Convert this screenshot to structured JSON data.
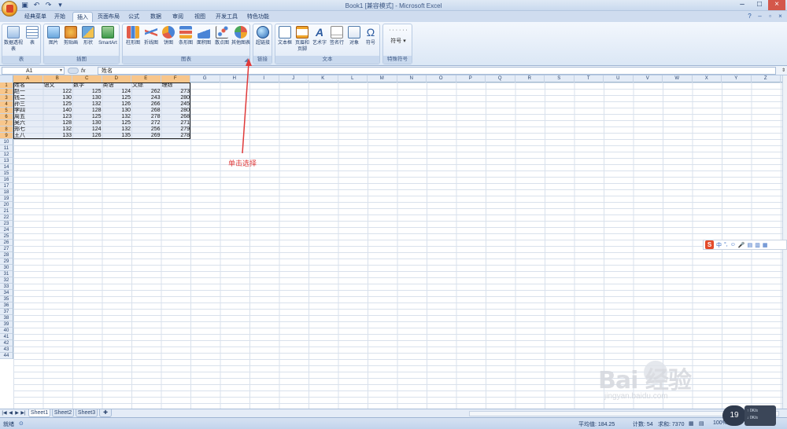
{
  "window": {
    "title": "Book1  [兼容模式] - Microsoft Excel"
  },
  "quick_access": {
    "icons": [
      "save-icon",
      "undo-icon",
      "redo-icon",
      "customize-icon"
    ]
  },
  "tabs": [
    {
      "label": "经典菜单"
    },
    {
      "label": "开始"
    },
    {
      "label": "插入",
      "active": true
    },
    {
      "label": "页面布局"
    },
    {
      "label": "公式"
    },
    {
      "label": "数据"
    },
    {
      "label": "审阅"
    },
    {
      "label": "视图"
    },
    {
      "label": "开发工具"
    },
    {
      "label": "特色功能"
    }
  ],
  "ribbon": {
    "groups": {
      "table": {
        "label": "表",
        "buttons": [
          {
            "label": "数据透视表"
          },
          {
            "label": "表"
          }
        ]
      },
      "illustrations": {
        "label": "插图",
        "buttons": [
          {
            "label": "图片"
          },
          {
            "label": "剪贴画"
          },
          {
            "label": "形状"
          },
          {
            "label": "SmartArt"
          }
        ]
      },
      "charts": {
        "label": "图表",
        "buttons": [
          {
            "label": "柱形图"
          },
          {
            "label": "折线图"
          },
          {
            "label": "饼图"
          },
          {
            "label": "条形图"
          },
          {
            "label": "面积图"
          },
          {
            "label": "散点图"
          },
          {
            "label": "其他图表"
          }
        ]
      },
      "links": {
        "label": "链接",
        "buttons": [
          {
            "label": "超链接"
          }
        ]
      },
      "text": {
        "label": "文本",
        "buttons": [
          {
            "label": "文本框"
          },
          {
            "label": "页眉和页脚"
          },
          {
            "label": "艺术字"
          },
          {
            "label": "签名行"
          },
          {
            "label": "对象"
          },
          {
            "label": "符号"
          }
        ]
      },
      "special": {
        "label": "特殊符号",
        "buttons": [
          {
            "label": "符号"
          }
        ]
      }
    }
  },
  "formula_bar": {
    "name_box": "A1",
    "fx_label": "fx",
    "content": "姓名"
  },
  "columns": [
    "A",
    "B",
    "C",
    "D",
    "E",
    "F",
    "G",
    "H",
    "I",
    "J",
    "K",
    "L",
    "M",
    "N",
    "O",
    "P",
    "Q",
    "R",
    "S",
    "T",
    "U",
    "V",
    "W",
    "X",
    "Y",
    "Z"
  ],
  "rows_count": 44,
  "table": {
    "headers": [
      "姓名",
      "语文",
      "数学",
      "英语",
      "文综",
      "理综"
    ],
    "rows": [
      [
        "赵一",
        "122",
        "125",
        "124",
        "262",
        "273"
      ],
      [
        "钱二",
        "130",
        "130",
        "125",
        "243",
        "280"
      ],
      [
        "孙三",
        "125",
        "132",
        "126",
        "266",
        "245"
      ],
      [
        "李四",
        "140",
        "128",
        "130",
        "268",
        "280"
      ],
      [
        "周五",
        "123",
        "125",
        "132",
        "278",
        "268"
      ],
      [
        "吴六",
        "128",
        "130",
        "125",
        "272",
        "271"
      ],
      [
        "郑七",
        "132",
        "124",
        "132",
        "256",
        "279"
      ],
      [
        "王八",
        "133",
        "126",
        "135",
        "269",
        "278"
      ]
    ]
  },
  "annotation": {
    "text": "单击选择",
    "color": "#e03a3a"
  },
  "sheets": [
    {
      "label": "Sheet1",
      "active": true
    },
    {
      "label": "Sheet2"
    },
    {
      "label": "Sheet3"
    }
  ],
  "status": {
    "ready": "就绪",
    "average": "平均值: 184.25",
    "count": "计数: 54",
    "sum": "求和: 7370",
    "zoom": "100%"
  },
  "overlay": {
    "zoom_badge": "19",
    "net_up": "0K/s",
    "net_down": "0K/s"
  },
  "watermark": {
    "brand": "Bai 经验",
    "url": "jingyan.baidu.com"
  },
  "ime": {
    "items": [
      "中",
      "°,",
      "☺",
      "🎤"
    ]
  },
  "colors": {
    "accent": "#2b5aa0",
    "selected_header": "#f8c68b",
    "annotation": "#e03a3a"
  }
}
